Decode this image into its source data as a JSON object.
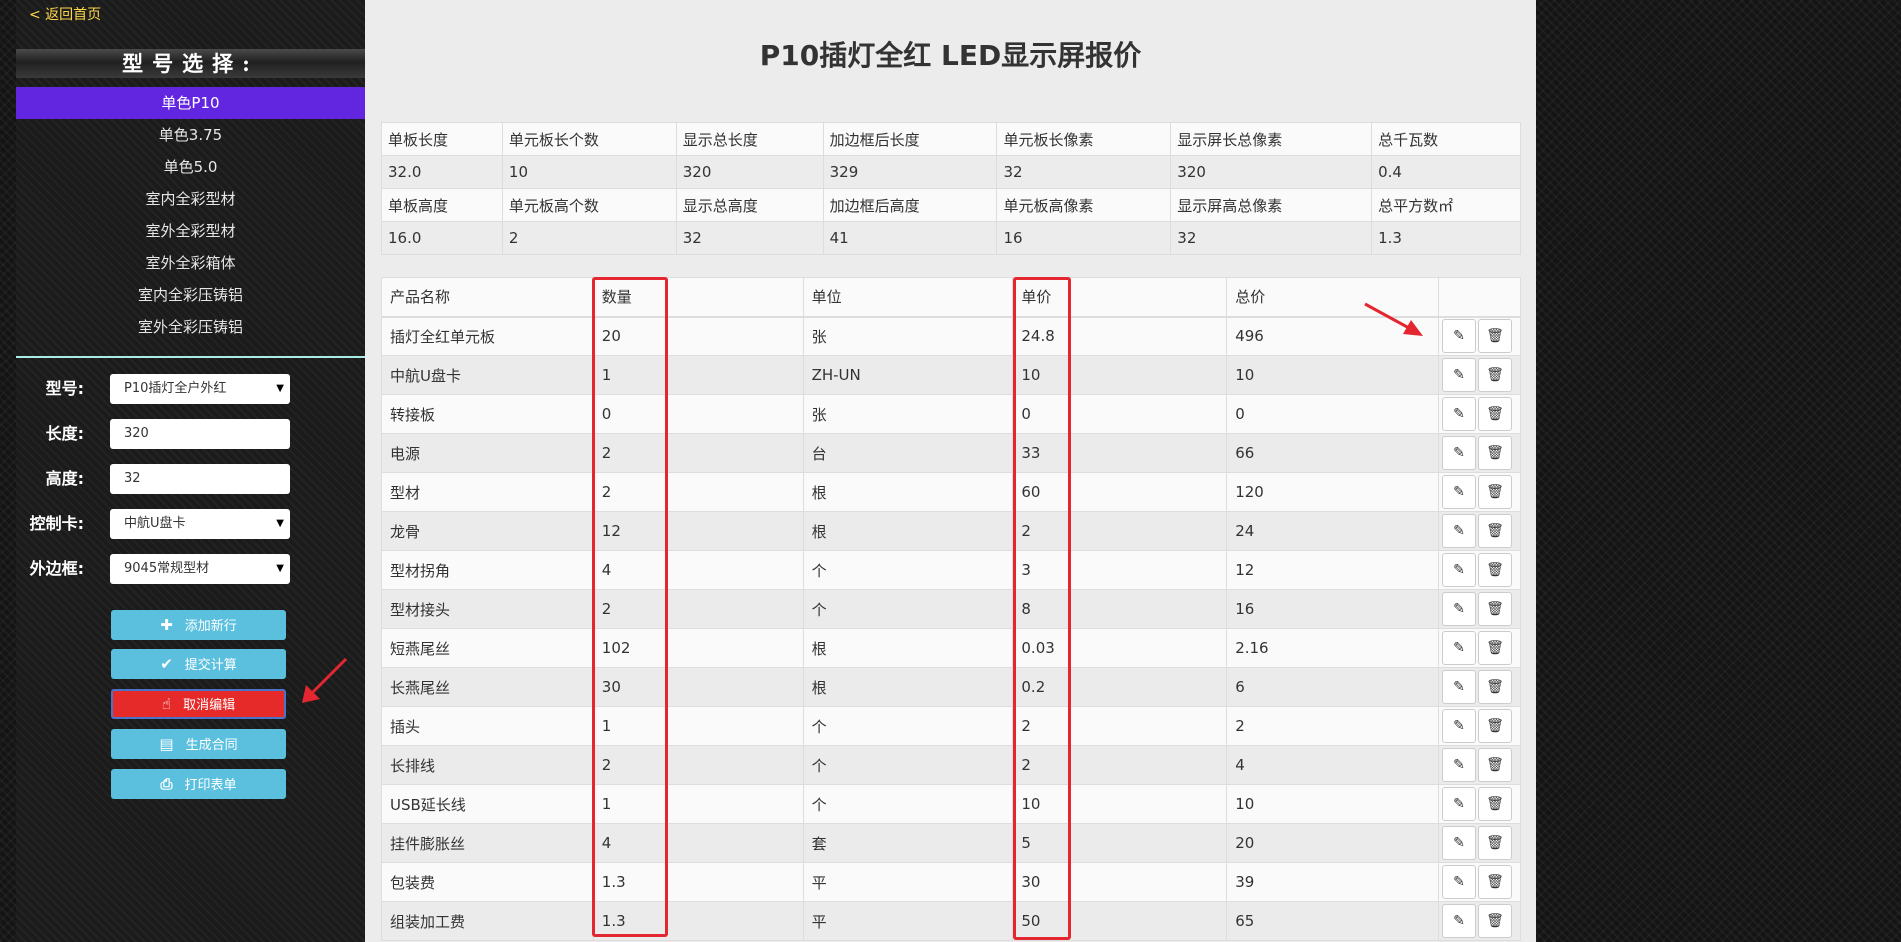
{
  "sidebar": {
    "back_link": "< 返回首页",
    "model_header": "型号选择:",
    "model_items": [
      {
        "label": "单色P10",
        "active": true
      },
      {
        "label": "单色3.75",
        "active": false
      },
      {
        "label": "单色5.0",
        "active": false
      },
      {
        "label": "室内全彩型材",
        "active": false
      },
      {
        "label": "室外全彩型材",
        "active": false
      },
      {
        "label": "室外全彩箱体",
        "active": false
      },
      {
        "label": "室内全彩压铸铝",
        "active": false
      },
      {
        "label": "室外全彩压铸铝",
        "active": false
      }
    ],
    "form": {
      "model_label": "型号:",
      "model_value": "P10插灯全户外红",
      "length_label": "长度:",
      "length_value": "320",
      "height_label": "高度:",
      "height_value": "32",
      "card_label": "控制卡:",
      "card_value": "中航U盘卡",
      "frame_label": "外边框:",
      "frame_value": "9045常规型材"
    },
    "buttons": {
      "add_row": "添加新行",
      "submit_calc": "提交计算",
      "cancel_edit": "取消编辑",
      "gen_contract": "生成合同",
      "print_form": "打印表单"
    }
  },
  "main": {
    "title": "P10插灯全红 LED显示屏报价",
    "spec_table": [
      [
        "单板长度",
        "单元板长个数",
        "显示总长度",
        "加边框后长度",
        "单元板长像素",
        "显示屏长总像素",
        "总千瓦数"
      ],
      [
        "32.0",
        "10",
        "320",
        "329",
        "32",
        "320",
        "0.4"
      ],
      [
        "单板高度",
        "单元板高个数",
        "显示总高度",
        "加边框后高度",
        "单元板高像素",
        "显示屏高总像素",
        "总平方数㎡"
      ],
      [
        "16.0",
        "2",
        "32",
        "41",
        "16",
        "32",
        "1.3"
      ]
    ],
    "product_table": {
      "headers": [
        "产品名称",
        "数量",
        "单位",
        "单价",
        "总价"
      ],
      "rows": [
        [
          "插灯全红单元板",
          "20",
          "张",
          "24.8",
          "496"
        ],
        [
          "中航U盘卡",
          "1",
          "ZH-UN",
          "10",
          "10"
        ],
        [
          "转接板",
          "0",
          "张",
          "0",
          "0"
        ],
        [
          "电源",
          "2",
          "台",
          "33",
          "66"
        ],
        [
          "型材",
          "2",
          "根",
          "60",
          "120"
        ],
        [
          "龙骨",
          "12",
          "根",
          "2",
          "24"
        ],
        [
          "型材拐角",
          "4",
          "个",
          "3",
          "12"
        ],
        [
          "型材接头",
          "2",
          "个",
          "8",
          "16"
        ],
        [
          "短燕尾丝",
          "102",
          "根",
          "0.03",
          "2.16"
        ],
        [
          "长燕尾丝",
          "30",
          "根",
          "0.2",
          "6"
        ],
        [
          "插头",
          "1",
          "个",
          "2",
          "2"
        ],
        [
          "长排线",
          "2",
          "个",
          "2",
          "4"
        ],
        [
          "USB延长线",
          "1",
          "个",
          "10",
          "10"
        ],
        [
          "挂件膨胀丝",
          "4",
          "套",
          "5",
          "20"
        ],
        [
          "包装费",
          "1.3",
          "平",
          "30",
          "39"
        ],
        [
          "组装加工费",
          "1.3",
          "平",
          "50",
          "65"
        ]
      ]
    }
  },
  "icons": {
    "edit": "pencil-icon",
    "delete": "trash-icon",
    "add": "plus-icon",
    "submit": "check-icon",
    "cancel": "hand-pointer-icon",
    "contract": "document-icon",
    "print": "printer-icon"
  },
  "colors": {
    "active_menu": "#6226e0",
    "button_info": "#5bc0de",
    "button_danger": "#e62a2a",
    "annotation_red": "#e3262f",
    "back_link": "#ffd84a"
  }
}
